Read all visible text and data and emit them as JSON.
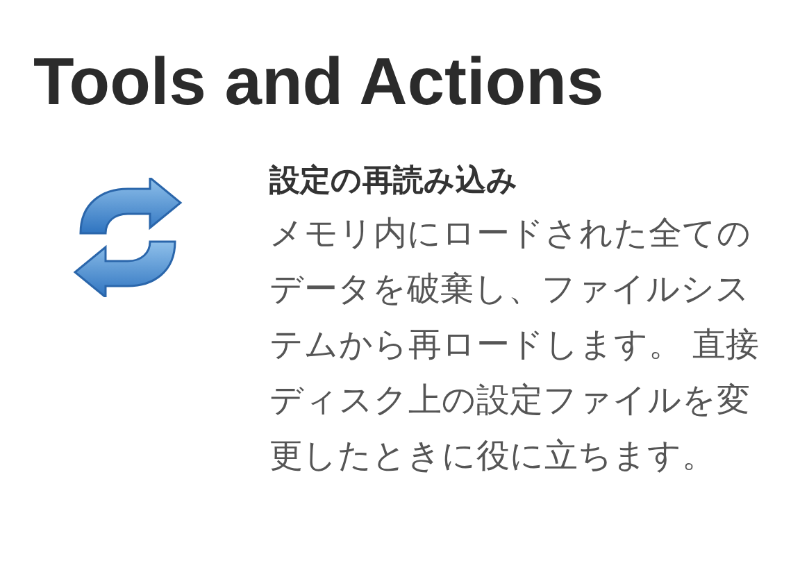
{
  "heading": "Tools and Actions",
  "items": [
    {
      "title": "設定の再読み込み",
      "description": "メモリ内にロードされた全てのデータを破棄し、ファイルシステムから再ロードします。 直接ディスク上の設定ファイルを変更したときに役に立ちます。"
    }
  ]
}
